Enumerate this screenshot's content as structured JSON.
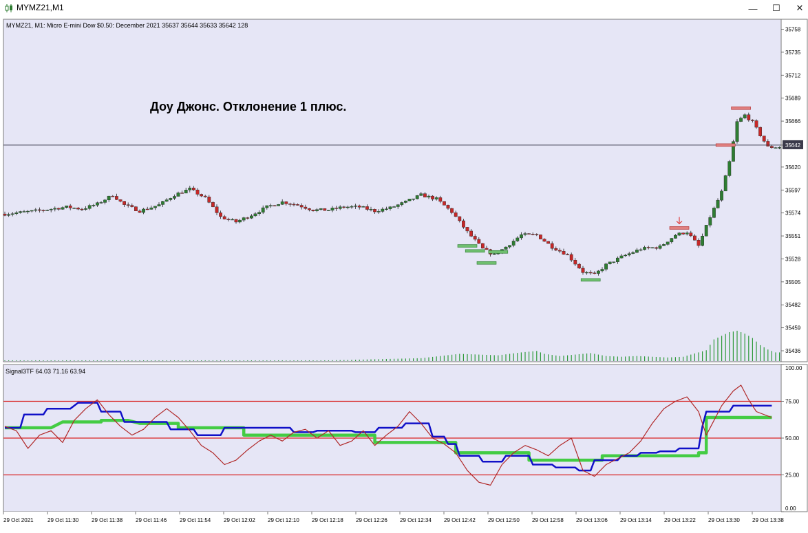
{
  "window": {
    "title": "MYMZ21,M1",
    "minimize_glyph": "—",
    "maximize_glyph": "☐",
    "close_glyph": "✕"
  },
  "colors": {
    "plot_bg": "#e6e6f6",
    "bull": "#2e7d32",
    "bear": "#c62828",
    "volume": "#2e9a3a",
    "level_line": "#d92222",
    "blue_line": "#1010c8",
    "green_line": "#44cc44",
    "osc_line": "#b02828"
  },
  "main_header": {
    "symbol": "MYMZ21, M1:",
    "desc": "Micro E-mini Dow $0.50: December 2021",
    "ohlc": "35637 35644 35633 35642",
    "volume": "128"
  },
  "annotation": "Доу Джонс. Отклонение 1 плюс.",
  "price_scale": [
    "35758",
    "35735",
    "35712",
    "35689",
    "35666",
    "35642",
    "35620",
    "35597",
    "35574",
    "35551",
    "35528",
    "35505",
    "35482",
    "35459",
    "35436"
  ],
  "current_price_label": "35642",
  "osc_header": "Signal3TF 64.03 71.16 63.94",
  "osc_scale": [
    "100.00",
    "75.00",
    "50.00",
    "25.00",
    "0.00"
  ],
  "time_labels": [
    "29 Oct 2021",
    "29 Oct 11:30",
    "29 Oct 11:38",
    "29 Oct 11:46",
    "29 Oct 11:54",
    "29 Oct 12:02",
    "29 Oct 12:10",
    "29 Oct 12:18",
    "29 Oct 12:26",
    "29 Oct 12:34",
    "29 Oct 12:42",
    "29 Oct 12:50",
    "29 Oct 12:58",
    "29 Oct 13:06",
    "29 Oct 13:14",
    "29 Oct 13:22",
    "29 Oct 13:30",
    "29 Oct 13:38"
  ],
  "chart_data": [
    {
      "type": "candlestick",
      "title": "MYMZ21, M1: Micro E-mini Dow $0.50: December 2021",
      "ylim": [
        35425,
        35768
      ],
      "current_price": 35642,
      "price_anchors": [
        [
          0,
          35573
        ],
        [
          8,
          35576
        ],
        [
          16,
          35580
        ],
        [
          20,
          35578
        ],
        [
          24,
          35583
        ],
        [
          28,
          35592
        ],
        [
          31,
          35582
        ],
        [
          35,
          35576
        ],
        [
          40,
          35582
        ],
        [
          44,
          35592
        ],
        [
          48,
          35598
        ],
        [
          52,
          35589
        ],
        [
          56,
          35570
        ],
        [
          60,
          35565
        ],
        [
          64,
          35572
        ],
        [
          68,
          35580
        ],
        [
          72,
          35585
        ],
        [
          76,
          35582
        ],
        [
          80,
          35577
        ],
        [
          84,
          35577
        ],
        [
          88,
          35580
        ],
        [
          92,
          35580
        ],
        [
          96,
          35576
        ],
        [
          100,
          35579
        ],
        [
          104,
          35585
        ],
        [
          108,
          35592
        ],
        [
          112,
          35588
        ],
        [
          116,
          35575
        ],
        [
          120,
          35555
        ],
        [
          124,
          35538
        ],
        [
          127,
          35532
        ],
        [
          130,
          35540
        ],
        [
          134,
          35552
        ],
        [
          138,
          35552
        ],
        [
          142,
          35540
        ],
        [
          146,
          35532
        ],
        [
          150,
          35515
        ],
        [
          153,
          35512
        ],
        [
          156,
          35522
        ],
        [
          160,
          35530
        ],
        [
          165,
          35538
        ],
        [
          170,
          35540
        ],
        [
          174,
          35552
        ],
        [
          177,
          35555
        ],
        [
          180,
          35541
        ],
        [
          183,
          35570
        ],
        [
          186,
          35595
        ],
        [
          188,
          35625
        ],
        [
          190,
          35665
        ],
        [
          192,
          35672
        ],
        [
          194,
          35665
        ],
        [
          196,
          35652
        ],
        [
          198,
          35640
        ],
        [
          201,
          35640
        ]
      ]
    },
    {
      "type": "bar",
      "name": "volume",
      "bars": [
        [
          0,
          1
        ],
        [
          34,
          1
        ],
        [
          84,
          1
        ],
        [
          108,
          4
        ],
        [
          113,
          7
        ],
        [
          118,
          10
        ],
        [
          123,
          9
        ],
        [
          128,
          8
        ],
        [
          134,
          12
        ],
        [
          138,
          14
        ],
        [
          140,
          10
        ],
        [
          144,
          7
        ],
        [
          148,
          9
        ],
        [
          152,
          11
        ],
        [
          156,
          7
        ],
        [
          160,
          6
        ],
        [
          164,
          7
        ],
        [
          168,
          6
        ],
        [
          172,
          5
        ],
        [
          176,
          6
        ],
        [
          180,
          12
        ],
        [
          182,
          15
        ],
        [
          184,
          30
        ],
        [
          186,
          35
        ],
        [
          188,
          40
        ],
        [
          190,
          42
        ],
        [
          192,
          38
        ],
        [
          194,
          32
        ],
        [
          196,
          22
        ],
        [
          198,
          16
        ],
        [
          200,
          12
        ]
      ]
    },
    {
      "type": "line",
      "title": "Signal3TF 64.03 71.16 63.94",
      "ylim": [
        0,
        100
      ],
      "levels": [
        75,
        50,
        25
      ],
      "last_values": [
        64.03,
        71.16,
        63.94
      ],
      "series": [
        {
          "values": [
            [
              0,
              57
            ],
            [
              12,
              57
            ],
            [
              15,
              61
            ],
            [
              25,
              61
            ],
            [
              25,
              62
            ],
            [
              32,
              62
            ],
            [
              35,
              60
            ],
            [
              45,
              60
            ],
            [
              45,
              57
            ],
            [
              62,
              57
            ],
            [
              62,
              52
            ],
            [
              96,
              52
            ],
            [
              96,
              47
            ],
            [
              117,
              47
            ],
            [
              117,
              40
            ],
            [
              136,
              40
            ],
            [
              136,
              35
            ],
            [
              155,
              35
            ],
            [
              155,
              38
            ],
            [
              180,
              38
            ],
            [
              180,
              40
            ],
            [
              182,
              40
            ],
            [
              182,
              64
            ],
            [
              199,
              64
            ]
          ]
        },
        {
          "values": [
            [
              0,
              57
            ],
            [
              4,
              57
            ],
            [
              5,
              66
            ],
            [
              10,
              66
            ],
            [
              11,
              70
            ],
            [
              17,
              70
            ],
            [
              19,
              74
            ],
            [
              24,
              74
            ],
            [
              25,
              68
            ],
            [
              30,
              68
            ],
            [
              31,
              61
            ],
            [
              42,
              61
            ],
            [
              43,
              56
            ],
            [
              49,
              56
            ],
            [
              50,
              52
            ],
            [
              56,
              52
            ],
            [
              57,
              57
            ],
            [
              74,
              57
            ],
            [
              75,
              54
            ],
            [
              80,
              54
            ],
            [
              81,
              55
            ],
            [
              90,
              55
            ],
            [
              91,
              54
            ],
            [
              96,
              54
            ],
            [
              97,
              57
            ],
            [
              103,
              57
            ],
            [
              104,
              60
            ],
            [
              110,
              60
            ],
            [
              111,
              51
            ],
            [
              114,
              51
            ],
            [
              115,
              46
            ],
            [
              117,
              46
            ],
            [
              118,
              38
            ],
            [
              123,
              38
            ],
            [
              124,
              34
            ],
            [
              129,
              34
            ],
            [
              130,
              38
            ],
            [
              136,
              38
            ],
            [
              137,
              32
            ],
            [
              142,
              32
            ],
            [
              143,
              30
            ],
            [
              148,
              30
            ],
            [
              149,
              28
            ],
            [
              152,
              28
            ],
            [
              153,
              35
            ],
            [
              159,
              35
            ],
            [
              160,
              38
            ],
            [
              164,
              38
            ],
            [
              165,
              40
            ],
            [
              169,
              40
            ],
            [
              170,
              41
            ],
            [
              174,
              41
            ],
            [
              175,
              43
            ],
            [
              180,
              43
            ],
            [
              181,
              58
            ],
            [
              182,
              68
            ],
            [
              188,
              68
            ],
            [
              189,
              72
            ],
            [
              199,
              72
            ]
          ]
        },
        {
          "values": [
            [
              0,
              58
            ],
            [
              3,
              55
            ],
            [
              6,
              43
            ],
            [
              9,
              52
            ],
            [
              12,
              55
            ],
            [
              15,
              47
            ],
            [
              18,
              62
            ],
            [
              21,
              70
            ],
            [
              24,
              76
            ],
            [
              27,
              66
            ],
            [
              30,
              58
            ],
            [
              33,
              52
            ],
            [
              36,
              56
            ],
            [
              39,
              64
            ],
            [
              42,
              70
            ],
            [
              45,
              64
            ],
            [
              48,
              55
            ],
            [
              51,
              45
            ],
            [
              54,
              40
            ],
            [
              57,
              32
            ],
            [
              60,
              35
            ],
            [
              63,
              42
            ],
            [
              66,
              48
            ],
            [
              69,
              52
            ],
            [
              72,
              48
            ],
            [
              75,
              54
            ],
            [
              78,
              56
            ],
            [
              81,
              50
            ],
            [
              84,
              55
            ],
            [
              87,
              45
            ],
            [
              90,
              48
            ],
            [
              93,
              55
            ],
            [
              96,
              45
            ],
            [
              99,
              52
            ],
            [
              102,
              58
            ],
            [
              105,
              68
            ],
            [
              108,
              60
            ],
            [
              111,
              50
            ],
            [
              114,
              46
            ],
            [
              117,
              40
            ],
            [
              120,
              28
            ],
            [
              123,
              20
            ],
            [
              126,
              18
            ],
            [
              129,
              32
            ],
            [
              132,
              40
            ],
            [
              135,
              45
            ],
            [
              138,
              42
            ],
            [
              141,
              38
            ],
            [
              144,
              45
            ],
            [
              147,
              50
            ],
            [
              150,
              28
            ],
            [
              153,
              24
            ],
            [
              156,
              32
            ],
            [
              159,
              36
            ],
            [
              162,
              40
            ],
            [
              165,
              48
            ],
            [
              168,
              60
            ],
            [
              171,
              70
            ],
            [
              174,
              75
            ],
            [
              177,
              78
            ],
            [
              180,
              68
            ],
            [
              182,
              52
            ],
            [
              184,
              62
            ],
            [
              186,
              72
            ],
            [
              189,
              82
            ],
            [
              191,
              86
            ],
            [
              193,
              76
            ],
            [
              195,
              68
            ],
            [
              198,
              65
            ],
            [
              199,
              64
            ]
          ]
        }
      ]
    }
  ]
}
